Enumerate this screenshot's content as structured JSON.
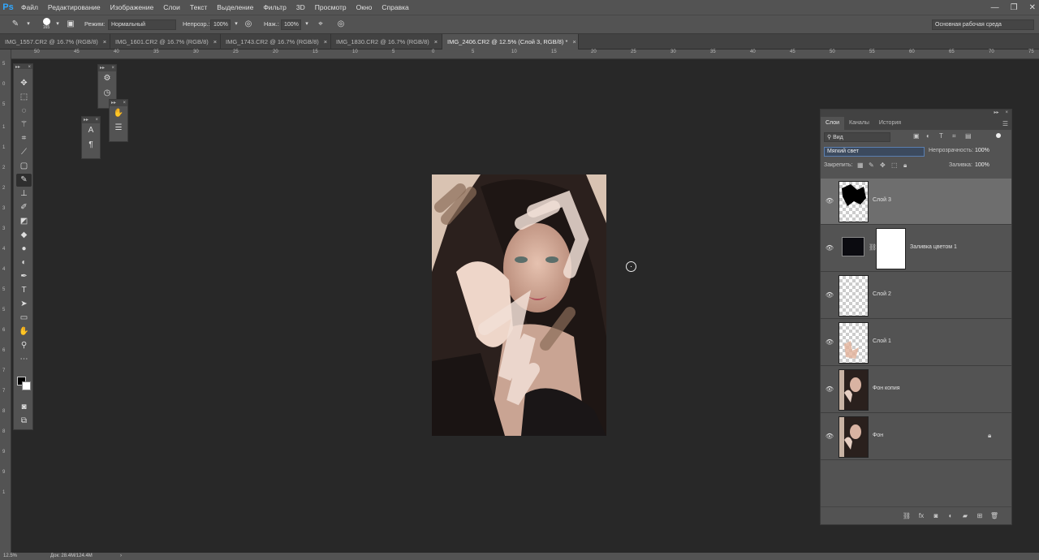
{
  "app": {
    "logo": "Ps"
  },
  "menu": {
    "items": [
      "Файл",
      "Редактирование",
      "Изображение",
      "Слои",
      "Текст",
      "Выделение",
      "Фильтр",
      "3D",
      "Просмотр",
      "Окно",
      "Справка"
    ]
  },
  "window_controls": {
    "minimize": "—",
    "restore": "❐",
    "close": "✕"
  },
  "options": {
    "brush_size": "165",
    "mode_label": "Режим:",
    "mode_value": "Нормальный",
    "opacity_label": "Непрозр.:",
    "opacity_value": "100%",
    "flow_label": "Наж.:",
    "flow_value": "100%",
    "workspace": "Основная рабочая среда"
  },
  "tabs": [
    {
      "label": "IMG_1557.CR2 @ 16.7% (RGB/8)",
      "close": "×"
    },
    {
      "label": "IMG_1601.CR2 @ 16.7% (RGB/8)",
      "close": "×"
    },
    {
      "label": "IMG_1743.CR2 @ 16.7% (RGB/8)",
      "close": "×"
    },
    {
      "label": "IMG_1830.CR2 @ 16.7% (RGB/8)",
      "close": "×"
    },
    {
      "label": "IMG_2406.CR2 @ 12.5% (Слой 3, RGB/8) *",
      "close": "×"
    }
  ],
  "ruler": {
    "top": [
      "50",
      "45",
      "40",
      "35",
      "30",
      "25",
      "20",
      "15",
      "10",
      "5",
      "0",
      "5",
      "10",
      "15",
      "20",
      "25",
      "30",
      "35",
      "40",
      "45",
      "50",
      "55",
      "60",
      "65",
      "70",
      "75",
      "80"
    ],
    "left": [
      "5",
      "0",
      "5",
      "1",
      "1",
      "2",
      "2",
      "3",
      "3",
      "4",
      "4",
      "5",
      "5",
      "6",
      "6",
      "7",
      "7",
      "8",
      "8",
      "9",
      "9",
      "1"
    ]
  },
  "layers_panel": {
    "tabs": [
      "Слои",
      "Каналы",
      "История"
    ],
    "filter_label": "Вид",
    "blend_mode": "Мягкий свет",
    "opacity_label": "Непрозрачность:",
    "opacity_value": "100%",
    "lock_label": "Закрепить:",
    "fill_label": "Заливка:",
    "fill_value": "100%",
    "layers": [
      {
        "name": "Слой 3"
      },
      {
        "name": "Заливка цветом 1"
      },
      {
        "name": "Слой 2"
      },
      {
        "name": "Слой 1"
      },
      {
        "name": "Фон копия"
      },
      {
        "name": "Фон"
      }
    ]
  },
  "status": {
    "zoom": "12.5%",
    "doc": "Док: 28.4M/124.4M",
    "arrow": "›"
  },
  "colors": {
    "chrome": "#535353",
    "workspace": "#282828",
    "accent": "#31a8ff",
    "selected_layer": "#6e6e6e"
  }
}
